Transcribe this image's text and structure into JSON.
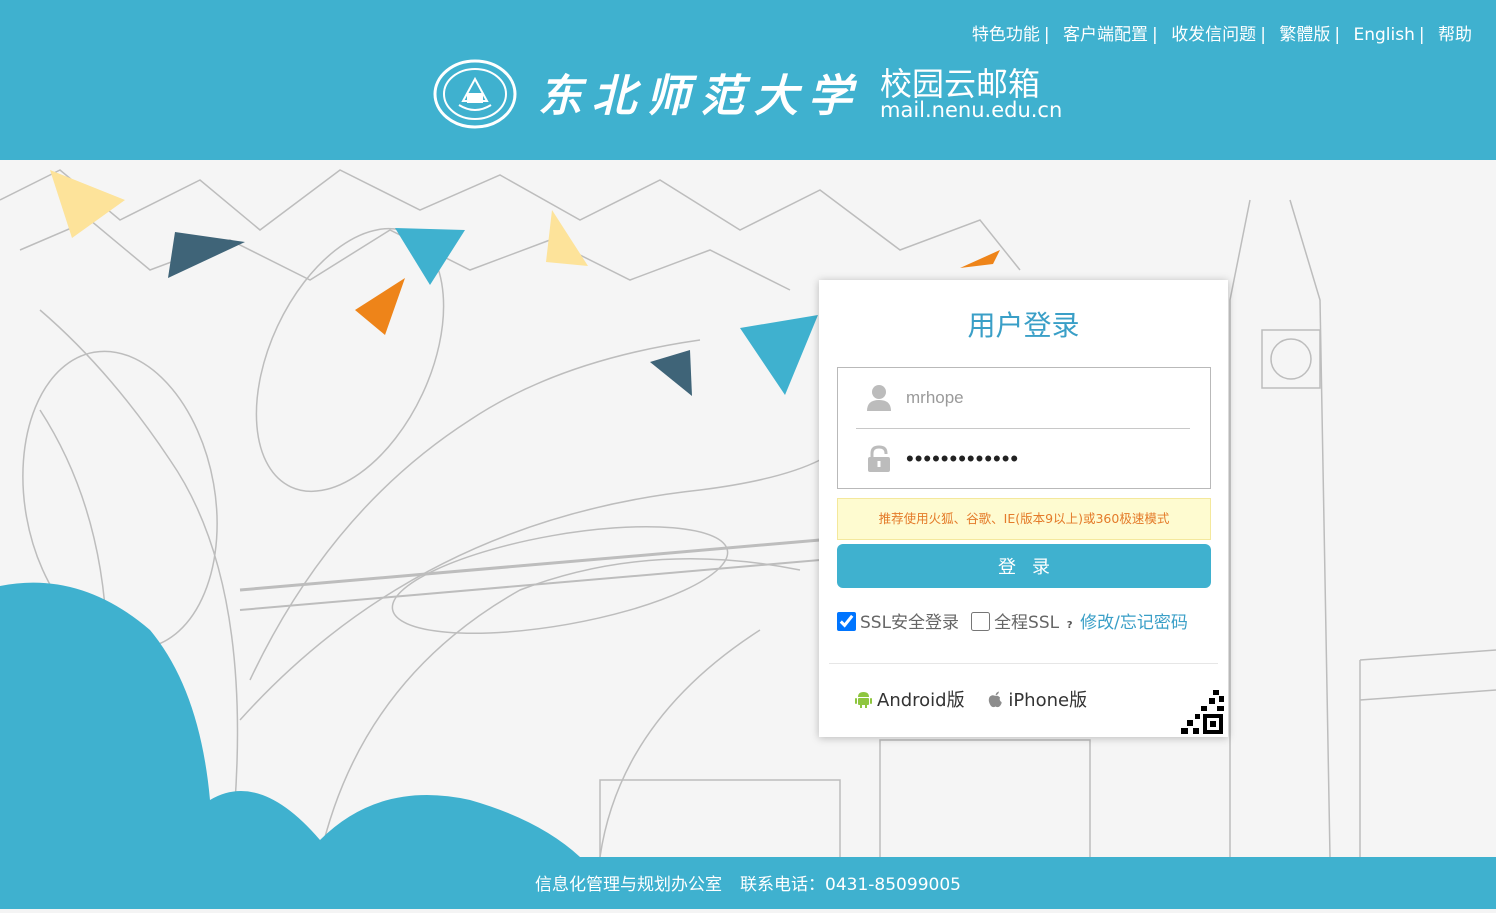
{
  "header": {
    "top_links": [
      "特色功能",
      "客户端配置",
      "收发信问题",
      "繁體版",
      "English",
      "帮助"
    ],
    "separator": "|",
    "university_name": "东北师范大学",
    "mailbox_title": "校园云邮箱",
    "mailbox_domain": "mail.nenu.edu.cn",
    "seal_icon": "university-seal-icon"
  },
  "login": {
    "title": "用户登录",
    "username_placeholder": "mrhope",
    "password_value": "•••••••••••••",
    "browser_tip": "推荐使用火狐、谷歌、IE(版本9以上)或360极速模式",
    "login_button": "登录",
    "ssl_label": "SSL安全登录",
    "ssl_checked": true,
    "full_ssl_label": "全程SSL",
    "full_ssl_checked": false,
    "help_mark": "?",
    "change_password_link": "修改/忘记密码",
    "apps": {
      "android": "Android版",
      "iphone": "iPhone版"
    }
  },
  "footer": {
    "office": "信息化管理与规划办公室",
    "phone_label": "联系电话：",
    "phone": "0431-85099005"
  },
  "colors": {
    "brand": "#3fb1cf",
    "title": "#3a9fc7",
    "tip_text": "#e47b2a",
    "tip_bg": "#fefbd0",
    "accent_yellow": "#fde39a",
    "accent_orange": "#ee8419",
    "accent_dark": "#3f6478"
  }
}
